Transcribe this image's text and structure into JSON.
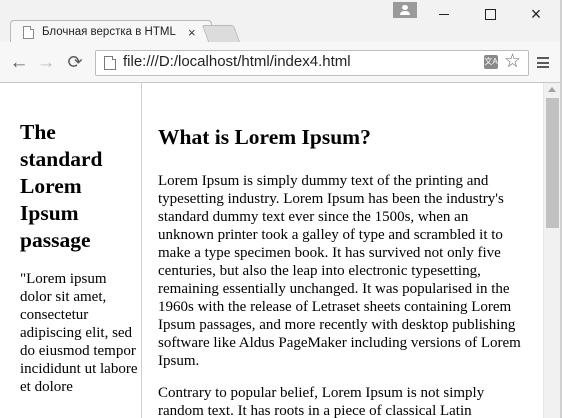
{
  "window": {
    "tab_title": "Блочная верстка в HTML",
    "tab_close": "×",
    "buttons": {
      "minimize": "minimize-icon",
      "maximize": "maximize-icon",
      "close": "×"
    }
  },
  "toolbar": {
    "back": "←",
    "forward": "→",
    "reload": "⟳",
    "url": "file:///D:/localhost/html/index4.html",
    "translate": "文A",
    "star": "☆"
  },
  "page": {
    "sidebar": {
      "title": "The standard Lorem Ipsum passage",
      "text": "\"Lorem ipsum dolor sit amet, consectetur adipiscing elit, sed do eiusmod tempor incididunt ut labore et dolore"
    },
    "main": {
      "title": "What is Lorem Ipsum?",
      "paragraph1": "Lorem Ipsum is simply dummy text of the printing and typesetting industry. Lorem Ipsum has been the industry's standard dummy text ever since the 1500s, when an unknown printer took a galley of type and scrambled it to make a type specimen book. It has survived not only five centuries, but also the leap into electronic typesetting, remaining essentially unchanged. It was popularised in the 1960s with the release of Letraset sheets containing Lorem Ipsum passages, and more recently with desktop publishing software like Aldus PageMaker including versions of Lorem Ipsum.",
      "paragraph2": "Contrary to popular belief, Lorem Ipsum is not simply random text. It has roots in a piece of classical Latin"
    }
  },
  "icons": {
    "tab": "page-icon",
    "profile": "person-icon",
    "omnibox": "page-icon",
    "menu": "hamburger-menu-icon"
  }
}
